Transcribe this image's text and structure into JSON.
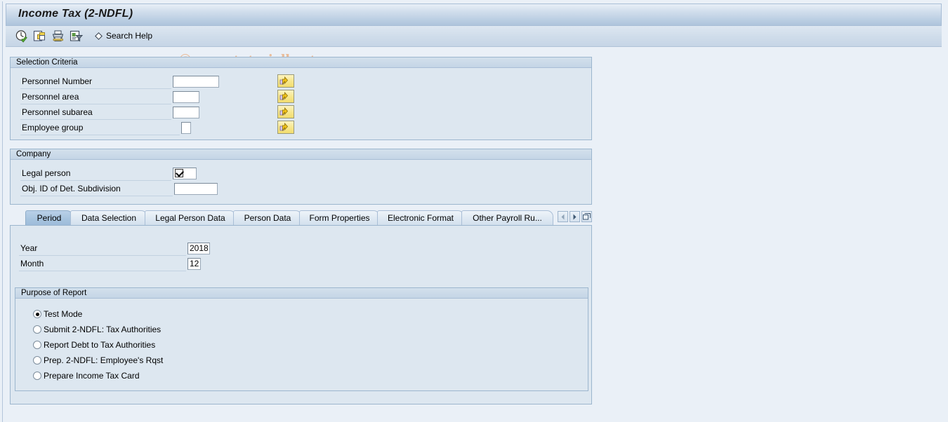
{
  "window": {
    "title": "Income Tax (2-NDFL)",
    "watermark": "© www.tutorialkart.com"
  },
  "toolbar": {
    "buttons": [
      {
        "name": "execute-icon",
        "tooltip": "Execute"
      },
      {
        "name": "copy-icon",
        "tooltip": "Get Variant"
      },
      {
        "name": "print-icon",
        "tooltip": "Print"
      },
      {
        "name": "variant-icon",
        "tooltip": "Save as Variant"
      }
    ],
    "search_help_label": "Search Help"
  },
  "selection_criteria": {
    "header": "Selection Criteria",
    "fields": [
      {
        "label": "Personnel Number",
        "value": "",
        "multi_btn": "multi-selection-arrow-icon"
      },
      {
        "label": "Personnel area",
        "value": "",
        "multi_btn": "multi-selection-arrow-icon"
      },
      {
        "label": "Personnel subarea",
        "value": "",
        "multi_btn": "multi-selection-arrow-icon"
      },
      {
        "label": "Employee group",
        "value": "",
        "multi_btn": "multi-selection-arrow-icon"
      }
    ]
  },
  "company": {
    "header": "Company",
    "legal_person_label": "Legal person",
    "legal_person_checked": true,
    "obj_id_label": "Obj. ID of Det. Subdivision",
    "obj_id_value": ""
  },
  "tabs": {
    "items": [
      {
        "label": "Period",
        "active": true
      },
      {
        "label": "Data Selection",
        "active": false
      },
      {
        "label": "Legal Person Data",
        "active": false
      },
      {
        "label": "Person Data",
        "active": false
      },
      {
        "label": "Form Properties",
        "active": false
      },
      {
        "label": "Electronic Format",
        "active": false
      },
      {
        "label": "Other Payroll Ru...",
        "active": false
      }
    ],
    "nav": {
      "prev": "chevron-left-icon",
      "next": "chevron-right-icon",
      "list": "tab-list-icon"
    }
  },
  "period": {
    "year_label": "Year",
    "year_value": "2018",
    "month_label": "Month",
    "month_value": "12"
  },
  "purpose_of_report": {
    "header": "Purpose of Report",
    "options": [
      {
        "label": "Test Mode",
        "selected": true
      },
      {
        "label": "Submit 2-NDFL: Tax Authorities",
        "selected": false
      },
      {
        "label": "Report Debt to Tax Authorities",
        "selected": false
      },
      {
        "label": "Prep. 2-NDFL: Employee's Rqst",
        "selected": false
      },
      {
        "label": "Prepare Income Tax Card",
        "selected": false
      }
    ]
  },
  "colors": {
    "title_bar": "#bccfe3",
    "panel_bg": "#dde7f0",
    "page_bg": "#eaf0f7",
    "accent_border": "#9cb6ce",
    "active_tab": "#a6c3de",
    "watermark": "#e9b38a",
    "button_yellow": "#f7e78d"
  }
}
